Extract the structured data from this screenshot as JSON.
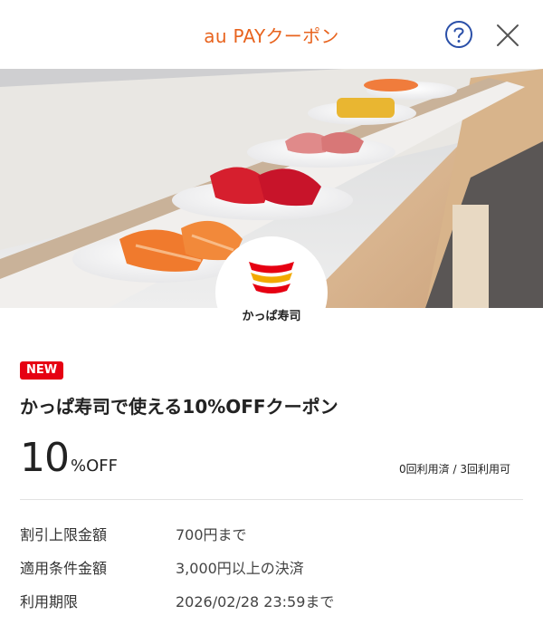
{
  "header": {
    "title": "au PAYクーポン",
    "help_icon": "question-circle-icon",
    "close_icon": "close-icon",
    "accent_color": "#e8641f"
  },
  "hero": {
    "brand_name": "かっぱ寿司",
    "logo_colors": [
      "#e60012",
      "#f2a900"
    ]
  },
  "coupon": {
    "badge": "NEW",
    "title": "かっぱ寿司で使える10%OFFクーポン",
    "discount_value": "10",
    "discount_unit": "%OFF",
    "usage": "0回利用済 / 3回利用可"
  },
  "details": [
    {
      "label": "割引上限金額",
      "value": "700円まで"
    },
    {
      "label": "適用条件金額",
      "value": "3,000円以上の決済"
    },
    {
      "label": "利用期限",
      "value": "2026/02/28 23:59まで"
    }
  ]
}
